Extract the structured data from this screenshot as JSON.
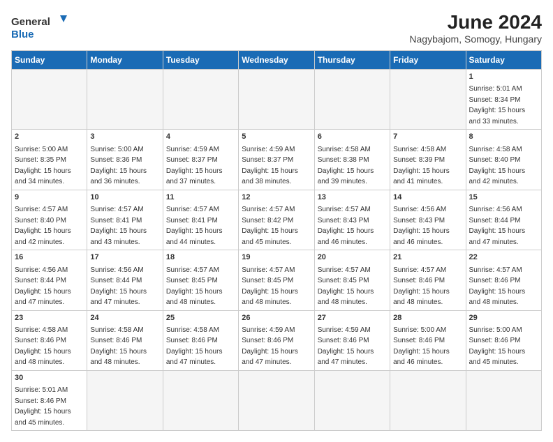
{
  "header": {
    "logo_general": "General",
    "logo_blue": "Blue",
    "month_title": "June 2024",
    "location": "Nagybajom, Somogy, Hungary"
  },
  "weekdays": [
    "Sunday",
    "Monday",
    "Tuesday",
    "Wednesday",
    "Thursday",
    "Friday",
    "Saturday"
  ],
  "days": {
    "1": {
      "sunrise": "5:01 AM",
      "sunset": "8:34 PM",
      "daylight": "15 hours and 33 minutes."
    },
    "2": {
      "sunrise": "5:00 AM",
      "sunset": "8:35 PM",
      "daylight": "15 hours and 34 minutes."
    },
    "3": {
      "sunrise": "5:00 AM",
      "sunset": "8:36 PM",
      "daylight": "15 hours and 36 minutes."
    },
    "4": {
      "sunrise": "4:59 AM",
      "sunset": "8:37 PM",
      "daylight": "15 hours and 37 minutes."
    },
    "5": {
      "sunrise": "4:59 AM",
      "sunset": "8:37 PM",
      "daylight": "15 hours and 38 minutes."
    },
    "6": {
      "sunrise": "4:58 AM",
      "sunset": "8:38 PM",
      "daylight": "15 hours and 39 minutes."
    },
    "7": {
      "sunrise": "4:58 AM",
      "sunset": "8:39 PM",
      "daylight": "15 hours and 41 minutes."
    },
    "8": {
      "sunrise": "4:58 AM",
      "sunset": "8:40 PM",
      "daylight": "15 hours and 42 minutes."
    },
    "9": {
      "sunrise": "4:57 AM",
      "sunset": "8:40 PM",
      "daylight": "15 hours and 42 minutes."
    },
    "10": {
      "sunrise": "4:57 AM",
      "sunset": "8:41 PM",
      "daylight": "15 hours and 43 minutes."
    },
    "11": {
      "sunrise": "4:57 AM",
      "sunset": "8:41 PM",
      "daylight": "15 hours and 44 minutes."
    },
    "12": {
      "sunrise": "4:57 AM",
      "sunset": "8:42 PM",
      "daylight": "15 hours and 45 minutes."
    },
    "13": {
      "sunrise": "4:57 AM",
      "sunset": "8:43 PM",
      "daylight": "15 hours and 46 minutes."
    },
    "14": {
      "sunrise": "4:56 AM",
      "sunset": "8:43 PM",
      "daylight": "15 hours and 46 minutes."
    },
    "15": {
      "sunrise": "4:56 AM",
      "sunset": "8:44 PM",
      "daylight": "15 hours and 47 minutes."
    },
    "16": {
      "sunrise": "4:56 AM",
      "sunset": "8:44 PM",
      "daylight": "15 hours and 47 minutes."
    },
    "17": {
      "sunrise": "4:56 AM",
      "sunset": "8:44 PM",
      "daylight": "15 hours and 47 minutes."
    },
    "18": {
      "sunrise": "4:57 AM",
      "sunset": "8:45 PM",
      "daylight": "15 hours and 48 minutes."
    },
    "19": {
      "sunrise": "4:57 AM",
      "sunset": "8:45 PM",
      "daylight": "15 hours and 48 minutes."
    },
    "20": {
      "sunrise": "4:57 AM",
      "sunset": "8:45 PM",
      "daylight": "15 hours and 48 minutes."
    },
    "21": {
      "sunrise": "4:57 AM",
      "sunset": "8:46 PM",
      "daylight": "15 hours and 48 minutes."
    },
    "22": {
      "sunrise": "4:57 AM",
      "sunset": "8:46 PM",
      "daylight": "15 hours and 48 minutes."
    },
    "23": {
      "sunrise": "4:58 AM",
      "sunset": "8:46 PM",
      "daylight": "15 hours and 48 minutes."
    },
    "24": {
      "sunrise": "4:58 AM",
      "sunset": "8:46 PM",
      "daylight": "15 hours and 48 minutes."
    },
    "25": {
      "sunrise": "4:58 AM",
      "sunset": "8:46 PM",
      "daylight": "15 hours and 47 minutes."
    },
    "26": {
      "sunrise": "4:59 AM",
      "sunset": "8:46 PM",
      "daylight": "15 hours and 47 minutes."
    },
    "27": {
      "sunrise": "4:59 AM",
      "sunset": "8:46 PM",
      "daylight": "15 hours and 47 minutes."
    },
    "28": {
      "sunrise": "5:00 AM",
      "sunset": "8:46 PM",
      "daylight": "15 hours and 46 minutes."
    },
    "29": {
      "sunrise": "5:00 AM",
      "sunset": "8:46 PM",
      "daylight": "15 hours and 45 minutes."
    },
    "30": {
      "sunrise": "5:01 AM",
      "sunset": "8:46 PM",
      "daylight": "15 hours and 45 minutes."
    }
  }
}
